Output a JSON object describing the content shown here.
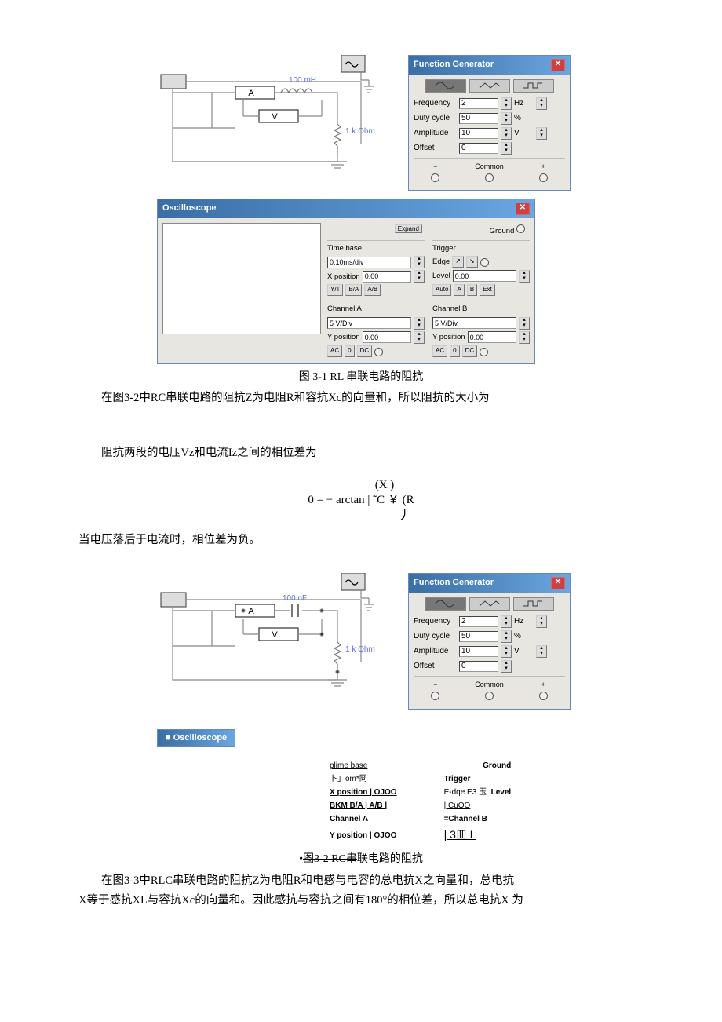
{
  "circuit1": {
    "component_value": "100 mH",
    "resistor_value": "1 k Ohm",
    "meter_a": "A",
    "meter_v": "V"
  },
  "circuit2": {
    "component_value": "100 nF",
    "resistor_value": "1 k Ohm",
    "meter_a": "A",
    "meter_v": "V"
  },
  "fg": {
    "title": "Function Generator",
    "freq_label": "Frequency",
    "freq_value": "2",
    "freq_unit": "Hz",
    "duty_label": "Duty cycle",
    "duty_value": "50",
    "duty_unit": "%",
    "amp_label": "Amplitude",
    "amp_value": "10",
    "amp_unit": "V",
    "off_label": "Offset",
    "off_value": "0",
    "minus": "−",
    "common": "Common",
    "plus": "+"
  },
  "osc": {
    "title": "Oscilloscope",
    "expand": "Expand",
    "ground": "Ground",
    "timebase": "Time base",
    "timebase_val": "0.10ms/div",
    "xpos": "X position",
    "xpos_val": "0.00",
    "ba": "B/A",
    "ab": "A/B",
    "trigger": "Trigger",
    "edge": "Edge",
    "level": "Level",
    "level_val": "0.00",
    "a": "A",
    "b": "B",
    "ext": "Ext",
    "cha": "Channel A",
    "chb": "Channel B",
    "vdiv": "5 V/Div",
    "ypos": "Y position",
    "ypos_val": "0.00",
    "ac": "AC",
    "zero": "0",
    "dc": "DC"
  },
  "osc2": {
    "title": "Oscilloscope",
    "col1_l1": "plime base",
    "col1_l2": "卜」om*冏",
    "col1_l3": "X position | OJOO",
    "col1_l4": "BKM B/A | A/B |",
    "col1_l5": "Channel A —",
    "col1_l6": "Y position | OJOO",
    "col2_l0": "Ground",
    "col2_l1": "Trigger —",
    "col2_l2a": "E-dqe E3 玉",
    "col2_l2b": "Level",
    "col2_l3": "| CuOO",
    "col2_l4": "=Channel B",
    "col2_l5": "| 3皿  L"
  },
  "text": {
    "caption1": "图 3-1 RL 串联电路的阻抗",
    "para1": "在图3-2中RC串联电路的阻抗Z为电阻R和容抗Xc的向量和，所以阻抗的大小为",
    "para2": "阻抗两段的电压Vz和电流Iz之间的相位差为",
    "formula_top": "(X )",
    "formula_mid": "0 = − arctan | ˜C ￥ (R",
    "formula_bot": "丿",
    "para3": "当电压落后于电流时，相位差为负。",
    "caption2_pre": "•",
    "caption2_strike": "图3-2 RC串",
    "caption2_post": "联电路的阻抗",
    "para4a": "在图3-3中RLC串联电路的阻抗Z为电阻R和电感与电容的总电抗X之向量和，总电抗",
    "para4b": "X等于感抗XL与容抗Xc的向量和。因此感抗与容抗之间有180°的相位差，所以总电抗X 为"
  }
}
